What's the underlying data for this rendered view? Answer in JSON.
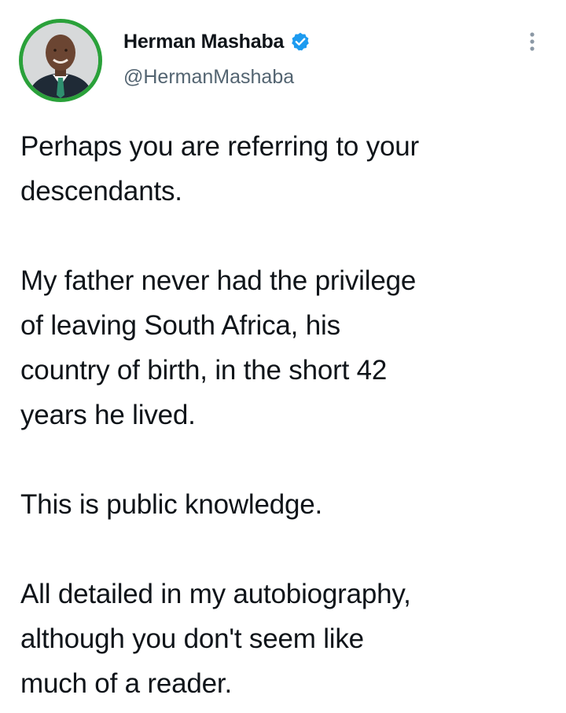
{
  "author": {
    "display_name": "Herman Mashaba",
    "handle": "@HermanMashaba",
    "verified": true,
    "avatar_ring_color": "#2aa13a",
    "verified_badge_color": "#1d9bf0"
  },
  "tweet": {
    "paragraphs": [
      "Perhaps you are referring to your\ndescendants.",
      "My father never had the privilege\nof leaving South Africa, his\ncountry of birth, in the short 42\nyears he lived.",
      "This is public knowledge.",
      "All detailed in my autobiography,\nalthough you don't seem like\nmuch of a reader."
    ]
  },
  "icons": {
    "more_menu": "more-vertical-icon",
    "verified": "verified-badge-icon"
  }
}
